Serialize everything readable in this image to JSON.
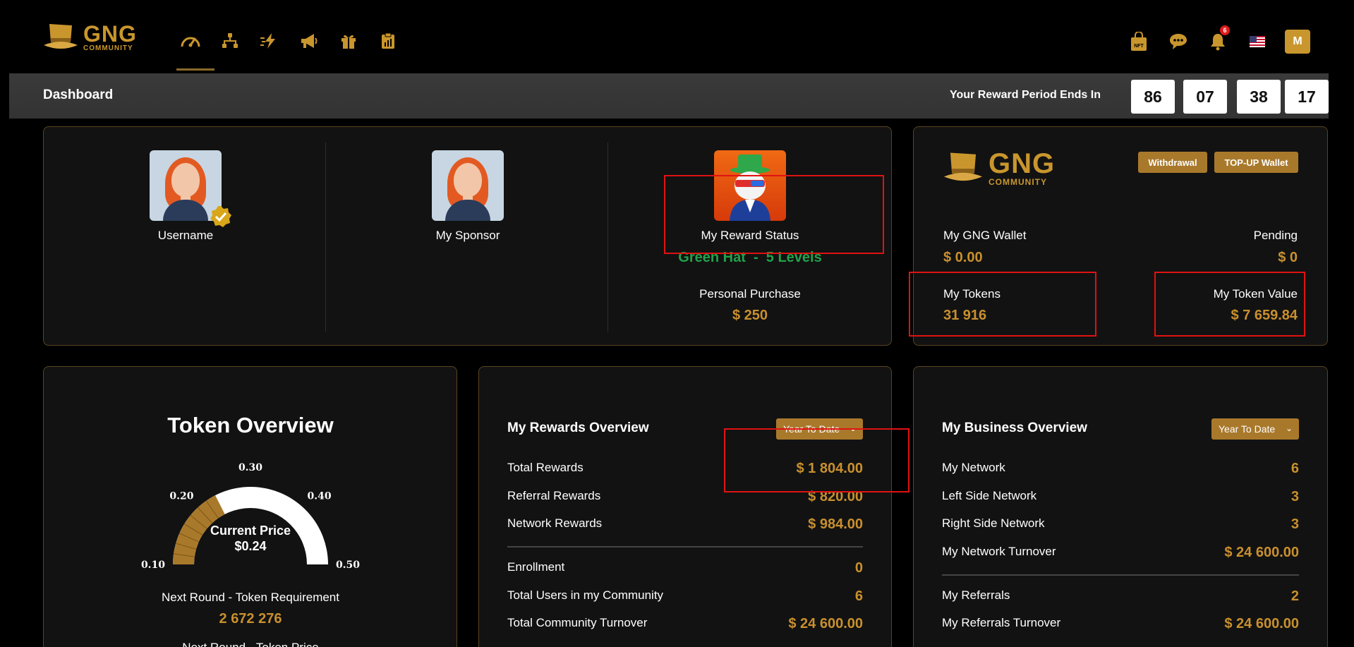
{
  "brand": {
    "name": "GNG",
    "sub": "COMMUNITY"
  },
  "nav": {
    "icons": [
      "dashboard-gauge-icon",
      "network-tree-icon",
      "lightning-icon",
      "megaphone-icon",
      "gift-icon",
      "clipboard-chart-icon"
    ],
    "notification_count": "6",
    "nft_label": "NFT",
    "avatar_initial": "M"
  },
  "dashboard": {
    "title": "Dashboard",
    "period_label": "Your Reward Period Ends In",
    "countdown": [
      "86",
      "07",
      "38",
      "17"
    ]
  },
  "profile": {
    "username_label": "Username",
    "sponsor_label": "My Sponsor",
    "reward_status_label": "My Reward Status",
    "reward_status_value": "Green Hat  -  5 Levels",
    "personal_purchase_label": "Personal Purchase",
    "personal_purchase_value": "$ 250"
  },
  "wallet": {
    "withdrawal_label": "Withdrawal",
    "topup_label": "TOP-UP Wallet",
    "gng_wallet_label": "My GNG Wallet",
    "gng_wallet_value": "$ 0.00",
    "pending_label": "Pending",
    "pending_value": "$ 0",
    "tokens_label": "My Tokens",
    "tokens_value": "31 916",
    "token_value_label": "My Token Value",
    "token_value_value": "$ 7 659.84"
  },
  "token_overview": {
    "title": "Token Overview",
    "ticks": [
      "0.10",
      "0.20",
      "0.30",
      "0.40",
      "0.50"
    ],
    "current_label": "Current Price",
    "current_value": "$0.24",
    "gauge_fraction": 0.35,
    "next_req_label": "Next Round - Token Requirement",
    "next_req_value": "2 672 276",
    "next_price_label": "Next Round - Token Price"
  },
  "rewards": {
    "title": "My Rewards Overview",
    "filter": "Year To Date",
    "rows": [
      {
        "label": "Total Rewards",
        "value": "$ 1 804.00"
      },
      {
        "label": "Referral Rewards",
        "value": "$ 820.00"
      },
      {
        "label": "Network Rewards",
        "value": "$ 984.00"
      }
    ],
    "rows2": [
      {
        "label": "Enrollment",
        "value": "0"
      },
      {
        "label": "Total Users in my Community",
        "value": "6"
      },
      {
        "label": "Total Community Turnover",
        "value": "$ 24 600.00"
      }
    ]
  },
  "business": {
    "title": "My Business Overview",
    "filter": "Year To Date",
    "rows": [
      {
        "label": "My Network",
        "value": "6"
      },
      {
        "label": "Left Side Network",
        "value": "3"
      },
      {
        "label": "Right Side Network",
        "value": "3"
      },
      {
        "label": "My Network Turnover",
        "value": "$ 24 600.00"
      }
    ],
    "rows2": [
      {
        "label": "My Referrals",
        "value": "2"
      },
      {
        "label": "My Referrals Turnover",
        "value": "$ 24 600.00"
      }
    ]
  },
  "colors": {
    "gold": "#c9902e",
    "button": "#a9792b",
    "green": "#21a24a",
    "highlight": "#e01212"
  }
}
